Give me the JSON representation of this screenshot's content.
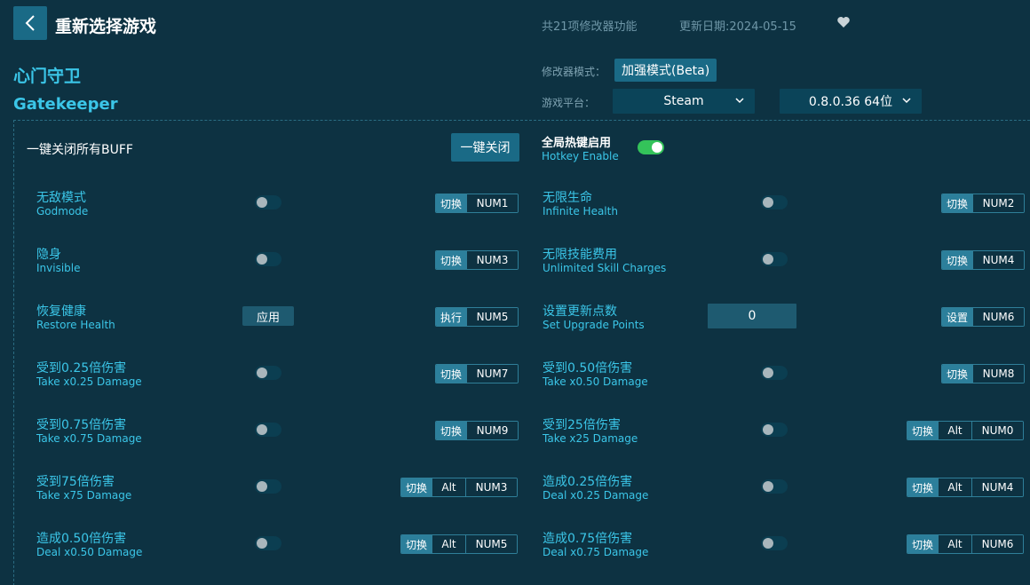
{
  "header": {
    "title": "重新选择游戏",
    "features_count": "共21项修改器功能",
    "update_date": "更新日期:2024-05-15"
  },
  "game": {
    "name_cn": "心门守卫",
    "name_en": "Gatekeeper"
  },
  "settings": {
    "mode_label": "修改器模式：",
    "mode_value": "加强模式(Beta)",
    "platform_label": "游戏平台：",
    "platform_value": "Steam",
    "version_value": "0.8.0.36 64位"
  },
  "buff": {
    "label": "一键关闭所有BUFF",
    "button": "一键关闭"
  },
  "hotkey": {
    "label_cn": "全局热键启用",
    "label_en": "Hotkey Enable",
    "enabled": true
  },
  "options": [
    {
      "cn": "无敌模式",
      "en": "Godmode",
      "control": "toggle",
      "action": "切换",
      "keys": [
        "NUM1"
      ]
    },
    {
      "cn": "无限生命",
      "en": "Infinite Health",
      "control": "toggle",
      "action": "切换",
      "keys": [
        "NUM2"
      ]
    },
    {
      "cn": "隐身",
      "en": "Invisible",
      "control": "toggle",
      "action": "切换",
      "keys": [
        "NUM3"
      ]
    },
    {
      "cn": "无限技能费用",
      "en": "Unlimited Skill Charges",
      "control": "toggle",
      "action": "切换",
      "keys": [
        "NUM4"
      ]
    },
    {
      "cn": "恢复健康",
      "en": "Restore Health",
      "control": "button",
      "button_label": "应用",
      "action": "执行",
      "keys": [
        "NUM5"
      ]
    },
    {
      "cn": "设置更新点数",
      "en": "Set Upgrade Points",
      "control": "input",
      "input_value": "0",
      "action": "设置",
      "keys": [
        "NUM6"
      ]
    },
    {
      "cn": "受到0.25倍伤害",
      "en": "Take x0.25 Damage",
      "control": "toggle",
      "action": "切换",
      "keys": [
        "NUM7"
      ]
    },
    {
      "cn": "受到0.50倍伤害",
      "en": "Take x0.50 Damage",
      "control": "toggle",
      "action": "切换",
      "keys": [
        "NUM8"
      ]
    },
    {
      "cn": "受到0.75倍伤害",
      "en": "Take x0.75 Damage",
      "control": "toggle",
      "action": "切换",
      "keys": [
        "NUM9"
      ]
    },
    {
      "cn": "受到25倍伤害",
      "en": "Take x25 Damage",
      "control": "toggle",
      "action": "切换",
      "keys": [
        "Alt",
        "NUM0"
      ]
    },
    {
      "cn": "受到75倍伤害",
      "en": "Take x75 Damage",
      "control": "toggle",
      "action": "切换",
      "keys": [
        "Alt",
        "NUM3"
      ]
    },
    {
      "cn": "造成0.25倍伤害",
      "en": "Deal x0.25 Damage",
      "control": "toggle",
      "action": "切换",
      "keys": [
        "Alt",
        "NUM4"
      ]
    },
    {
      "cn": "造成0.50倍伤害",
      "en": "Deal x0.50 Damage",
      "control": "toggle",
      "action": "切换",
      "keys": [
        "Alt",
        "NUM5"
      ]
    },
    {
      "cn": "造成0.75倍伤害",
      "en": "Deal x0.75 Damage",
      "control": "toggle",
      "action": "切换",
      "keys": [
        "Alt",
        "NUM6"
      ]
    }
  ]
}
